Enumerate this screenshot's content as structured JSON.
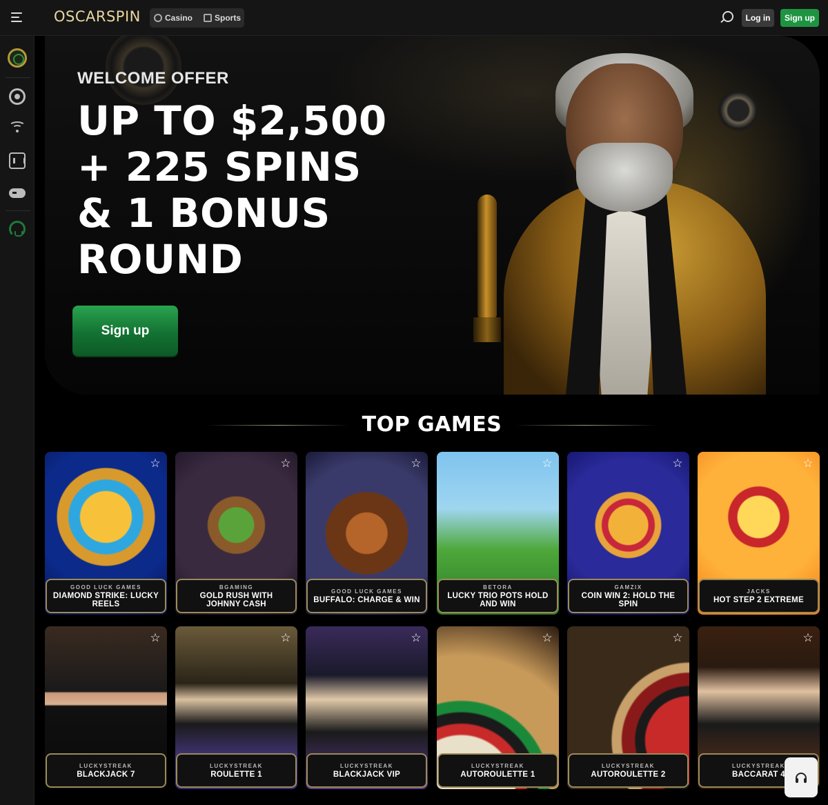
{
  "header": {
    "logo": "OSCARSPIN",
    "tabs": [
      {
        "label": "Casino",
        "icon": "casino-chip-icon"
      },
      {
        "label": "Sports",
        "icon": "sports-icon"
      }
    ],
    "login_label": "Log in",
    "signup_label": "Sign up"
  },
  "sidebar": {
    "items": [
      {
        "icon": "oscarspin-logo-icon"
      },
      {
        "icon": "casino-chip-icon"
      },
      {
        "icon": "live-broadcast-icon"
      },
      {
        "icon": "slot-machine-icon"
      },
      {
        "icon": "gamepad-icon"
      },
      {
        "icon": "support-headset-icon"
      }
    ]
  },
  "hero": {
    "offer_label": "WELCOME OFFER",
    "title_lines": [
      "UP TO $2,500",
      "+ 225 SPINS",
      "& 1 BONUS",
      "ROUND"
    ],
    "cta_label": "Sign up"
  },
  "top_games": {
    "heading": "TOP GAMES",
    "games": [
      {
        "provider": "GOOD LUCK GAMES",
        "name": "DIAMOND STRIKE: LUCKY REELS"
      },
      {
        "provider": "BGAMING",
        "name": "GOLD RUSH WITH JOHNNY CASH"
      },
      {
        "provider": "GOOD LUCK GAMES",
        "name": "BUFFALO: CHARGE & WIN"
      },
      {
        "provider": "BETORA",
        "name": "LUCKY TRIO POTS HOLD AND WIN"
      },
      {
        "provider": "GAMZIX",
        "name": "COIN WIN 2: HOLD THE SPIN"
      },
      {
        "provider": "JACKS",
        "name": "HOT STEP 2 EXTREME"
      },
      {
        "provider": "LUCKYSTREAK",
        "name": "BLACKJACK 7"
      },
      {
        "provider": "LUCKYSTREAK",
        "name": "ROULETTE 1"
      },
      {
        "provider": "LUCKYSTREAK",
        "name": "BLACKJACK VIP"
      },
      {
        "provider": "LUCKYSTREAK",
        "name": "AUTOROULETTE 1"
      },
      {
        "provider": "LUCKYSTREAK",
        "name": "AUTOROULETTE 2"
      },
      {
        "provider": "LUCKYSTREAK",
        "name": "BACCARAT 4"
      }
    ]
  },
  "colors": {
    "accent_green": "#1e9442",
    "gold_border": "#9c8a5a",
    "background": "#000000"
  }
}
